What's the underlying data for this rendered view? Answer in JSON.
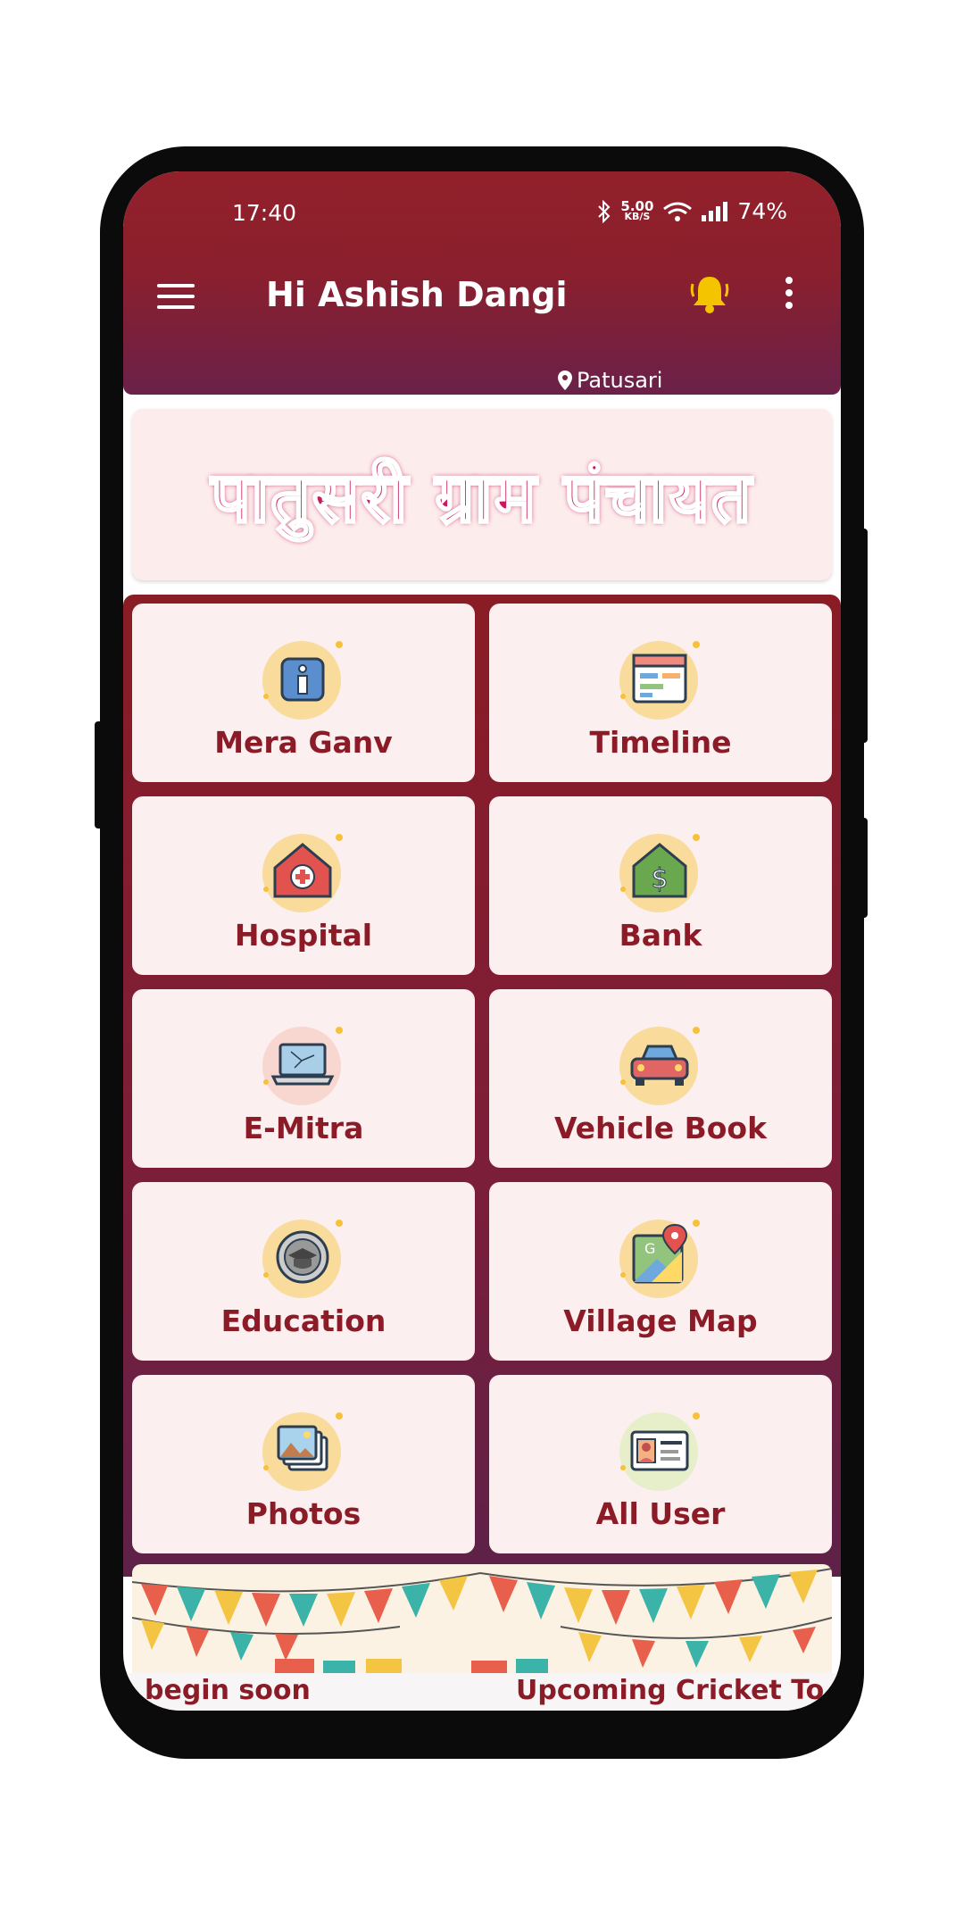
{
  "status_bar": {
    "time": "17:40",
    "net_speed_value": "5.00",
    "net_speed_unit": "KB/S",
    "battery": "74%"
  },
  "header": {
    "title": "Hi Ashish Dangi",
    "location": "Patusari"
  },
  "banner": {
    "text": "पातुसरी ग्राम पंचायत"
  },
  "tiles": [
    {
      "label": "Mera Ganv",
      "icon": "info-icon"
    },
    {
      "label": "Timeline",
      "icon": "calendar-icon"
    },
    {
      "label": "Hospital",
      "icon": "hospital-icon"
    },
    {
      "label": "Bank",
      "icon": "bank-icon"
    },
    {
      "label": "E-Mitra",
      "icon": "laptop-icon"
    },
    {
      "label": "Vehicle Book",
      "icon": "car-icon"
    },
    {
      "label": "Education",
      "icon": "graduation-cap-icon"
    },
    {
      "label": "Village Map",
      "icon": "map-icon"
    },
    {
      "label": "Photos",
      "icon": "photos-icon"
    },
    {
      "label": "All User",
      "icon": "id-card-icon"
    }
  ],
  "ticker": {
    "left_text": "begin soon",
    "right_text": "Upcoming Cricket To"
  },
  "colors": {
    "primary": "#8b1c27",
    "accent": "#6a2149",
    "bell": "#f5c400",
    "tile_bg": "#fcefef"
  }
}
